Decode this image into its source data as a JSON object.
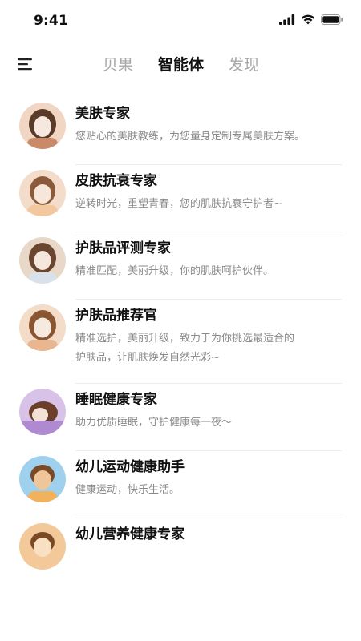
{
  "status": {
    "time": "9:41",
    "icons": [
      "signal-icon",
      "wifi-icon",
      "battery-icon"
    ]
  },
  "nav": {
    "menu_icon": "menu-icon",
    "tabs": [
      {
        "label": "贝果",
        "active": false
      },
      {
        "label": "智能体",
        "active": true
      },
      {
        "label": "发现",
        "active": false
      }
    ]
  },
  "agents": [
    {
      "name": "美肤专家",
      "desc": "您贴心的美肤教练，为您量身定制专属美肤方案。",
      "colors": [
        "#f2d6c4",
        "#5a3a28",
        "#f6e8de"
      ]
    },
    {
      "name": "皮肤抗衰专家",
      "desc": "逆转时光，重塑青春，您的肌肤抗衰守护者~",
      "colors": [
        "#f4dccb",
        "#8a5a3a",
        "#f3c89f"
      ]
    },
    {
      "name": "护肤品评测专家",
      "desc": "精准匹配，美丽升级，你的肌肤呵护伙伴。",
      "colors": [
        "#e9d8c8",
        "#6a4630",
        "#d9e2ea"
      ]
    },
    {
      "name": "护肤品推荐官",
      "desc": "精准选护，美丽升级，致力于为你挑选最适合的护肤品，让肌肤焕发自然光彩~",
      "desc_line1": "精准选护，美丽升级，致力于为你挑选最适合的",
      "desc_line2": "护肤品，让肌肤焕发自然光彩~",
      "colors": [
        "#f3dcc8",
        "#8a5632",
        "#f6e9de"
      ]
    },
    {
      "name": "睡眠健康专家",
      "desc": "助力优质睡眠，守护健康每一夜～",
      "colors": [
        "#d9c2e8",
        "#6b3f2a",
        "#b08ad0"
      ]
    },
    {
      "name": "幼儿运动健康助手",
      "desc": "健康运动，快乐生活。",
      "colors": [
        "#9fd0ee",
        "#7a4a26",
        "#f0c59a"
      ]
    },
    {
      "name": "幼儿营养健康专家",
      "desc": "",
      "colors": [
        "#f3c99a",
        "#7a4a26",
        "#f9e0c2"
      ]
    }
  ]
}
